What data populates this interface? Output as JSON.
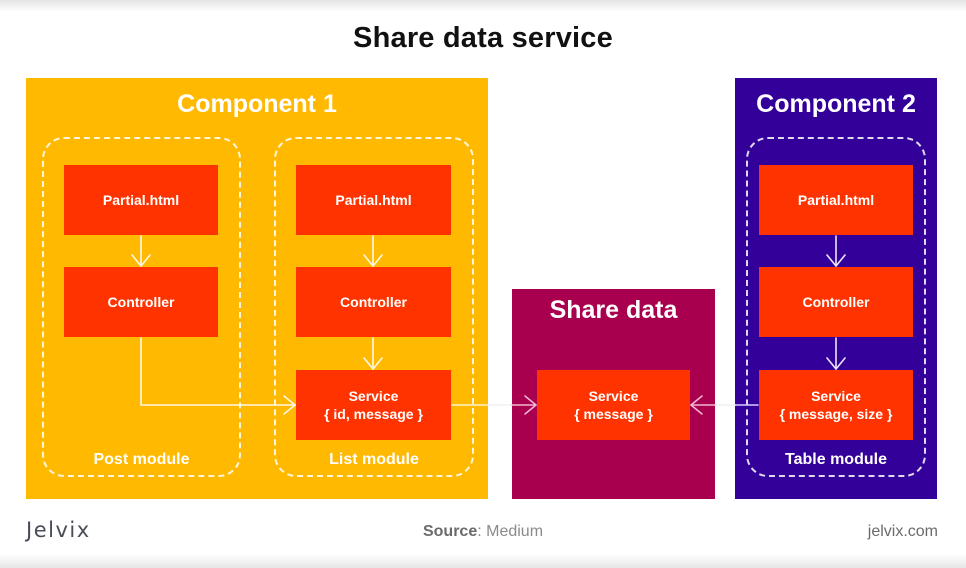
{
  "title": "Share data service",
  "colors": {
    "component1_bg": "#FFB900",
    "share_data_bg": "#A8004F",
    "component2_bg": "#330099",
    "box_bg": "#FF3300",
    "text_light": "#FFFFFF"
  },
  "component1": {
    "title": "Component 1",
    "modules": [
      {
        "label": "Post module",
        "boxes": [
          {
            "line1": "Partial.html"
          },
          {
            "line1": "Controller"
          }
        ]
      },
      {
        "label": "List module",
        "boxes": [
          {
            "line1": "Partial.html"
          },
          {
            "line1": "Controller"
          },
          {
            "line1": "Service",
            "line2": "{ id, message }"
          }
        ]
      }
    ]
  },
  "share_data": {
    "title": "Share data",
    "service": {
      "line1": "Service",
      "line2": "{ message }"
    }
  },
  "component2": {
    "title": "Component 2",
    "modules": [
      {
        "label": "Table module",
        "boxes": [
          {
            "line1": "Partial.html"
          },
          {
            "line1": "Controller"
          },
          {
            "line1": "Service",
            "line2": "{ message, size }"
          }
        ]
      }
    ]
  },
  "footer": {
    "brand": "Jelvix",
    "source_label": "Source",
    "source_value": ": Medium",
    "url": "jelvix.com"
  }
}
